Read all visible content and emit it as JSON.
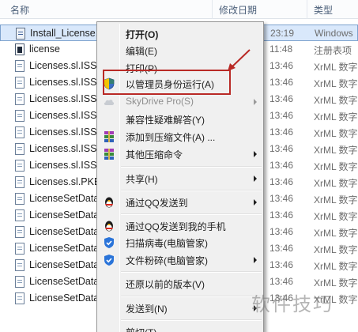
{
  "columns": {
    "name": "名称",
    "date": "修改日期",
    "type": "类型"
  },
  "files": [
    {
      "name": "Install_License.bat",
      "date": "23:19",
      "type": "Windows",
      "icon": "batch-file-icon",
      "selected": true
    },
    {
      "name": "license",
      "date": "11:48",
      "type": "注册表项",
      "icon": "license-file-icon"
    },
    {
      "name": "Licenses.sl.ISSUE",
      "date": "13:46",
      "type": "XrML 数字",
      "icon": "xml-doc-icon"
    },
    {
      "name": "Licenses.sl.ISSUE",
      "date": "13:46",
      "type": "XrML 数字",
      "icon": "xml-doc-icon"
    },
    {
      "name": "Licenses.sl.ISSUE",
      "date": "13:46",
      "type": "XrML 数字",
      "icon": "xml-doc-icon"
    },
    {
      "name": "Licenses.sl.ISSUE",
      "date": "13:46",
      "type": "XrML 数字",
      "icon": "xml-doc-icon"
    },
    {
      "name": "Licenses.sl.ISSUE",
      "date": "13:46",
      "type": "XrML 数字",
      "icon": "xml-doc-icon"
    },
    {
      "name": "Licenses.sl.ISSUE",
      "date": "13:46",
      "type": "XrML 数字",
      "icon": "xml-doc-icon"
    },
    {
      "name": "Licenses.sl.ISSUE",
      "date": "13:46",
      "type": "XrML 数字",
      "icon": "xml-doc-icon"
    },
    {
      "name": "Licenses.sl.PKEY",
      "date": "13:46",
      "type": "XrML 数字",
      "icon": "xml-doc-icon"
    },
    {
      "name": "LicenseSetData",
      "date": "13:46",
      "type": "XrML 数字",
      "icon": "xml-doc-icon"
    },
    {
      "name": "LicenseSetData",
      "date": "13:46",
      "type": "XrML 数字",
      "icon": "xml-doc-icon"
    },
    {
      "name": "LicenseSetData",
      "date": "13:46",
      "type": "XrML 数字",
      "icon": "xml-doc-icon"
    },
    {
      "name": "LicenseSetData",
      "date": "13:46",
      "type": "XrML 数字",
      "icon": "xml-doc-icon"
    },
    {
      "name": "LicenseSetData",
      "date": "13:46",
      "type": "XrML 数字",
      "icon": "xml-doc-icon"
    },
    {
      "name": "LicenseSetData",
      "date": "13:46",
      "type": "XrML 数字",
      "icon": "xml-doc-icon"
    },
    {
      "name": "LicenseSetData",
      "date": "13:46",
      "type": "XrML 数字",
      "icon": "xml-doc-icon"
    }
  ],
  "context_menu": {
    "open": "打开(O)",
    "edit": "编辑(E)",
    "print": "打印(P)",
    "run_as_admin": "以管理员身份运行(A)",
    "skydrive": "SkyDrive Pro(S)",
    "compat": "兼容性疑难解答(Y)",
    "add_to_archive": "添加到压缩文件(A) ...",
    "other_compress": "其他压缩命令",
    "share": "共享(H)",
    "qq_send": "通过QQ发送到",
    "qq_phone": "通过QQ发送到我的手机",
    "scan_virus": "扫描病毒(电脑管家)",
    "shred": "文件粉碎(电脑管家)",
    "restore": "还原以前的版本(V)",
    "send_to": "发送到(N)",
    "cut": "剪切(T)"
  },
  "watermark": "软件技巧",
  "colors": {
    "highlight_border": "#b92a26",
    "selection_bg": "#d9e8fb"
  }
}
